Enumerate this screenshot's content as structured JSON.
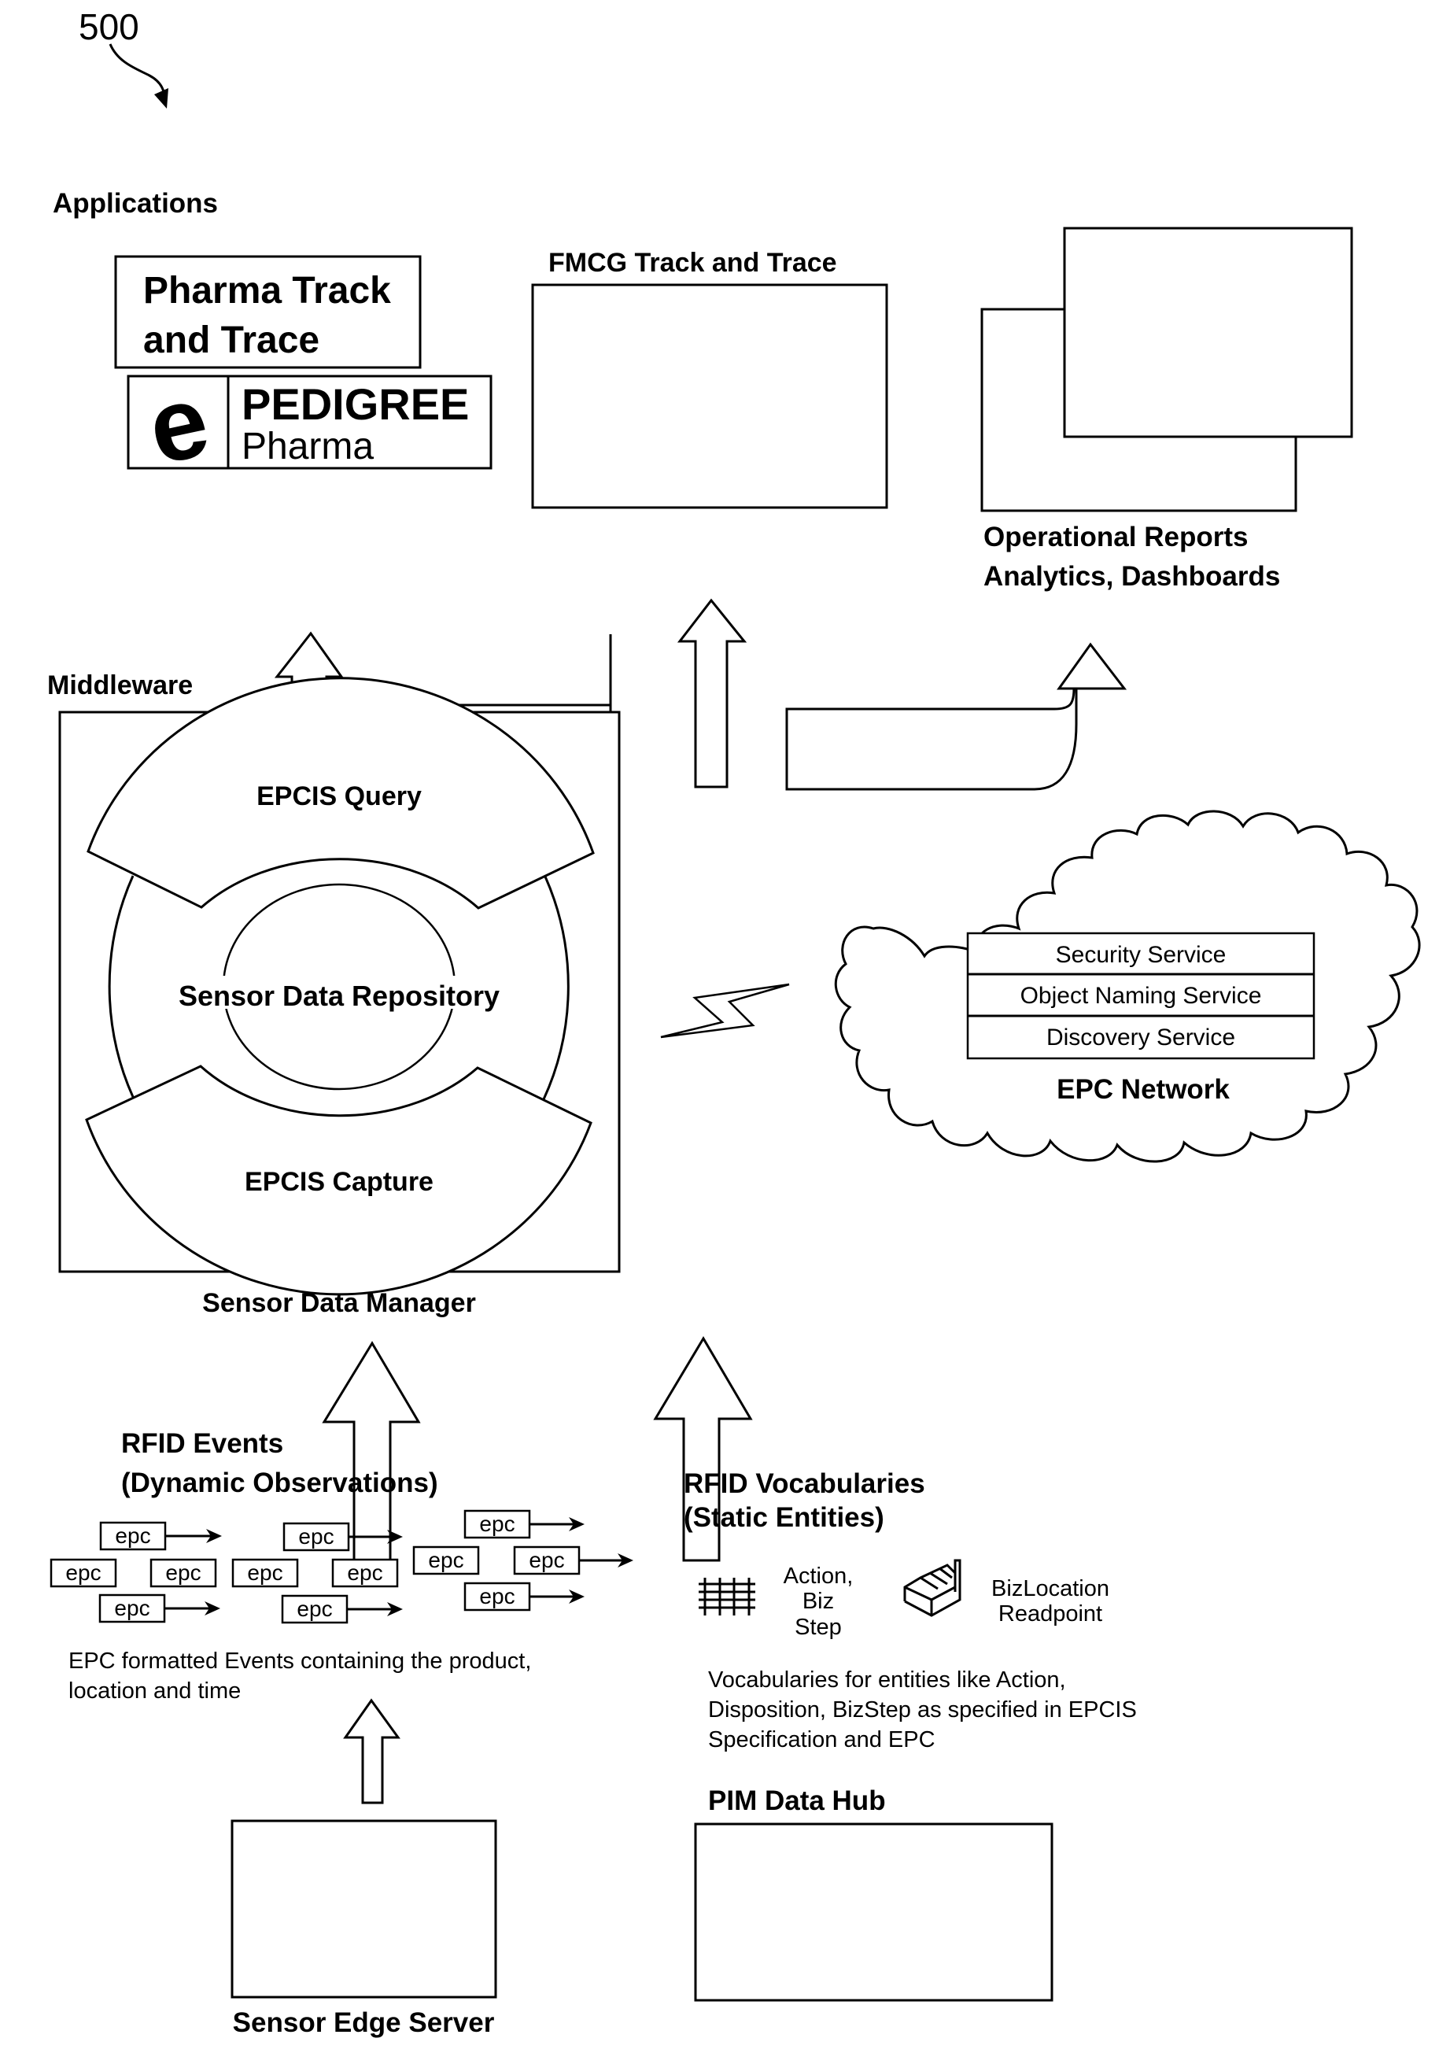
{
  "figure": {
    "reference_number": "500"
  },
  "applications": {
    "section_label": "Applications",
    "pharma": {
      "line1": "Pharma Track",
      "line2": "and Trace"
    },
    "pedigree_logo": {
      "icon": "e-letter-logo",
      "line1": "PEDIGREE",
      "line2": "Pharma"
    },
    "fmcg": {
      "label": "FMCG Track and Trace"
    },
    "reports": {
      "line1": "Operational Reports",
      "line2": "Analytics, Dashboards"
    }
  },
  "middleware": {
    "section_label": "Middleware",
    "query": "EPCIS Query",
    "repository": "Sensor Data Repository",
    "capture": "EPCIS Capture",
    "caption": "Sensor Data Manager"
  },
  "epc_network": {
    "services": [
      "Security Service",
      "Object Naming Service",
      "Discovery Service"
    ],
    "label": "EPC Network",
    "link_icon": "lightning-bolt-icon"
  },
  "rfid_events": {
    "line1": "RFID Events",
    "line2": "(Dynamic Observations)",
    "tag_label": "epc",
    "description_line1": "EPC formatted Events containing the product,",
    "description_line2": "location and time"
  },
  "rfid_vocabularies": {
    "line1": "RFID Vocabularies",
    "line2": "(Static Entities)",
    "items": [
      {
        "icon": "grid-icon",
        "lines": [
          "Action,",
          "Biz",
          "Step"
        ]
      },
      {
        "icon": "rfid-reader-icon",
        "lines": [
          "BizLocation",
          "Readpoint"
        ]
      }
    ],
    "description_lines": [
      "Vocabularies for entities like Action,",
      "Disposition, BizStep as specified in EPCIS",
      "Specification and EPC"
    ]
  },
  "sources": {
    "sensor_edge_server": "Sensor Edge Server",
    "pim_data_hub": "PIM Data Hub"
  }
}
